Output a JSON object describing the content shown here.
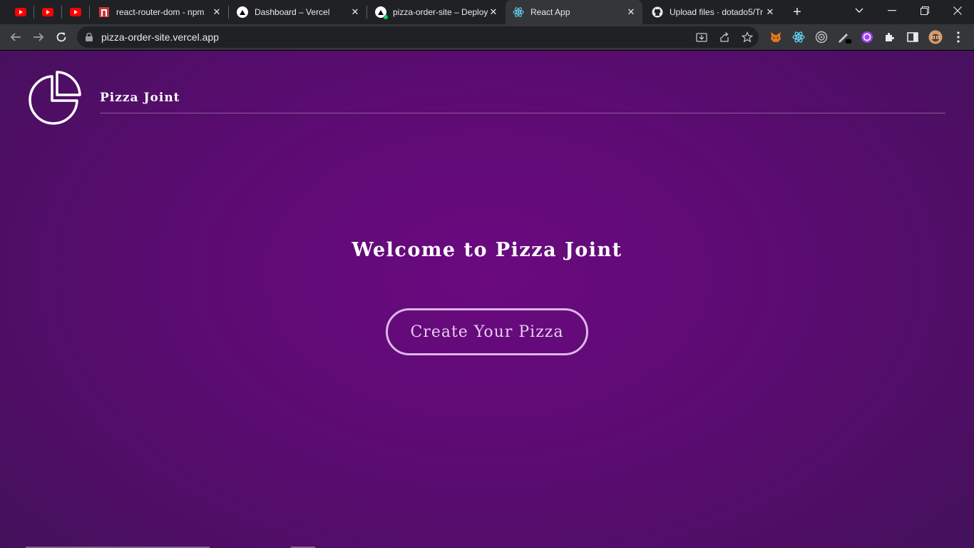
{
  "browser": {
    "tabs": [
      {
        "icon": "youtube-icon",
        "title": "",
        "pinned": true
      },
      {
        "icon": "youtube-icon",
        "title": "",
        "pinned": true
      },
      {
        "icon": "youtube-icon",
        "title": "",
        "pinned": true
      },
      {
        "icon": "npm-icon",
        "title": "react-router-dom - npm",
        "pinned": false
      },
      {
        "icon": "vercel-icon",
        "title": "Dashboard – Vercel",
        "pinned": false
      },
      {
        "icon": "vercel-icon",
        "title": "pizza-order-site – Deploy",
        "pinned": false
      },
      {
        "icon": "react-icon",
        "title": "React App",
        "pinned": false,
        "active": true
      },
      {
        "icon": "github-icon",
        "title": "Upload files · dotado5/Tr",
        "pinned": false
      }
    ],
    "url": "pizza-order-site.vercel.app"
  },
  "page": {
    "brand": "Pizza Joint",
    "headline": "Welcome to Pizza Joint",
    "cta_label": "Create Your Pizza"
  },
  "colors": {
    "background": "#5e0b74",
    "button_border": "#d8b9e6",
    "text": "#ffffff"
  }
}
